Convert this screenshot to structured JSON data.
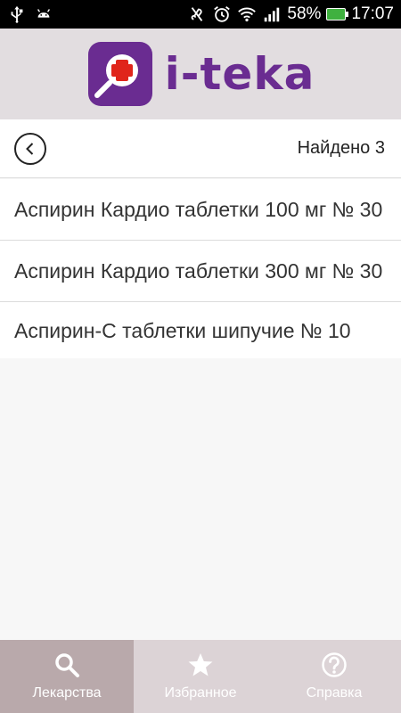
{
  "status_bar": {
    "battery": "58%",
    "time": "17:07",
    "icons": [
      "usb-icon",
      "android-icon",
      "mute-icon",
      "alarm-icon",
      "wifi-icon",
      "signal-icon",
      "battery-icon"
    ]
  },
  "header": {
    "logo_text": "i-teka",
    "brand_color": "#6a2c91",
    "accent_color": "#e0251b"
  },
  "results": {
    "found_label": "Найдено 3",
    "items": [
      "Аспирин Кардио таблетки 100 мг № 30",
      "Аспирин Кардио таблетки 300 мг № 30",
      "Аспирин-С таблетки шипучие № 10"
    ]
  },
  "bottom_nav": {
    "tabs": [
      {
        "label": "Лекарства",
        "icon": "search-icon",
        "active": true
      },
      {
        "label": "Избранное",
        "icon": "star-icon",
        "active": false
      },
      {
        "label": "Справка",
        "icon": "help-icon",
        "active": false
      }
    ]
  }
}
